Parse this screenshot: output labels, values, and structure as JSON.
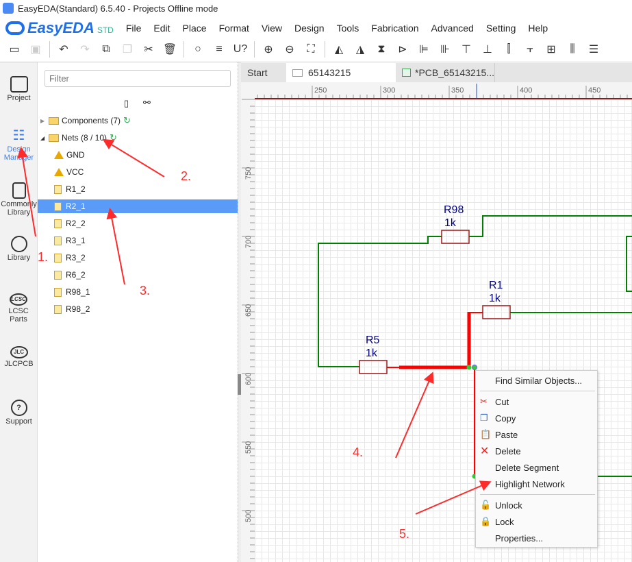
{
  "window": {
    "title": "EasyEDA(Standard) 6.5.40 - Projects Offline mode"
  },
  "brand": {
    "name": "EasyEDA",
    "edition": "STD"
  },
  "menu": [
    "File",
    "Edit",
    "Place",
    "Format",
    "View",
    "Design",
    "Tools",
    "Fabrication",
    "Advanced",
    "Setting",
    "Help"
  ],
  "toolbar": {
    "icons": [
      "open-icon",
      "save-icon",
      "undo-icon",
      "redo-icon",
      "duplicate-icon",
      "copy-icon",
      "cut-icon",
      "delete-icon",
      "search-icon",
      "find-list-icon",
      "annotate-icon",
      "zoom-in-icon",
      "zoom-out-icon",
      "fit-icon"
    ]
  },
  "iconbar": [
    {
      "label": "Project"
    },
    {
      "label": "Design Manager",
      "active": true
    },
    {
      "label": "Commonly Library"
    },
    {
      "label": "Library"
    },
    {
      "label": "LCSC Parts"
    },
    {
      "label": "JLCPCB"
    },
    {
      "label": "Support"
    }
  ],
  "panel": {
    "filter_placeholder": "Filter",
    "components": "Components (7)",
    "nets": "Nets (8 / 10)",
    "net_items": [
      {
        "name": "GND",
        "warn": true
      },
      {
        "name": "VCC",
        "warn": true
      },
      {
        "name": "R1_2"
      },
      {
        "name": "R2_1",
        "selected": true
      },
      {
        "name": "R2_2"
      },
      {
        "name": "R3_1"
      },
      {
        "name": "R3_2"
      },
      {
        "name": "R6_2"
      },
      {
        "name": "R98_1"
      },
      {
        "name": "R98_2"
      }
    ]
  },
  "tabs": [
    {
      "label": "Start"
    },
    {
      "label": "65143215",
      "active": true
    },
    {
      "label": "*PCB_65143215..."
    }
  ],
  "ruler": {
    "top": [
      "250",
      "300",
      "350",
      "400",
      "450"
    ],
    "left": [
      "750",
      "700",
      "650",
      "600",
      "550",
      "500"
    ]
  },
  "schematic": {
    "parts": [
      {
        "ref": "R98",
        "value": "1k"
      },
      {
        "ref": "R1",
        "value": "1k"
      },
      {
        "ref": "R5",
        "value": "1k"
      }
    ],
    "wire_color": "#008000",
    "highlight_color": "#ff0000"
  },
  "context_menu": {
    "items": [
      "Find Similar Objects...",
      "Cut",
      "Copy",
      "Paste",
      "Delete",
      "Delete Segment",
      "Highlight Network",
      "Unlock",
      "Lock",
      "Properties..."
    ]
  },
  "annotations": [
    "1.",
    "2.",
    "3.",
    "4.",
    "5."
  ],
  "colors": {
    "accent": "#3b7ff0",
    "selection": "#5b9bf8",
    "annotation": "#ff2a2a"
  }
}
